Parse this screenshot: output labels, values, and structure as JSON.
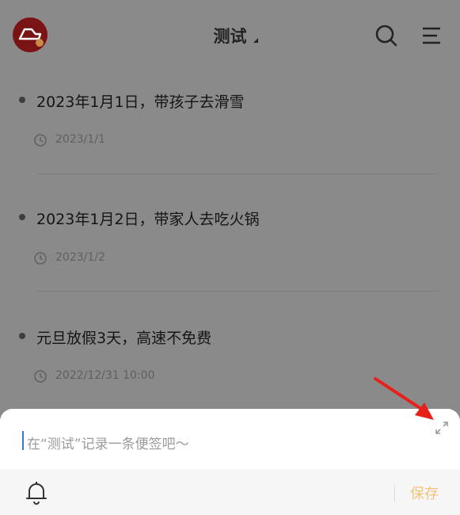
{
  "header": {
    "title": "测试",
    "icons": [
      "app-logo-icon",
      "search-icon",
      "menu-icon"
    ]
  },
  "notes": [
    {
      "text": "2023年1月1日，带孩子去滑雪",
      "time": "2023/1/1"
    },
    {
      "text": "2023年1月2日，带家人去吃火锅",
      "time": "2023/1/2"
    },
    {
      "text": "元旦放假3天，高速不免费",
      "time": "2022/12/31 10:00"
    }
  ],
  "composer": {
    "placeholder": "在“测试”记录一条便签吧～",
    "save_label": "保存",
    "icons": [
      "bell-icon",
      "expand-icon"
    ]
  },
  "colors": {
    "overlay": "#8a8a8a",
    "app_icon": "#7a1414",
    "save": "#f2c27a",
    "annotation_arrow": "#e8201a"
  }
}
